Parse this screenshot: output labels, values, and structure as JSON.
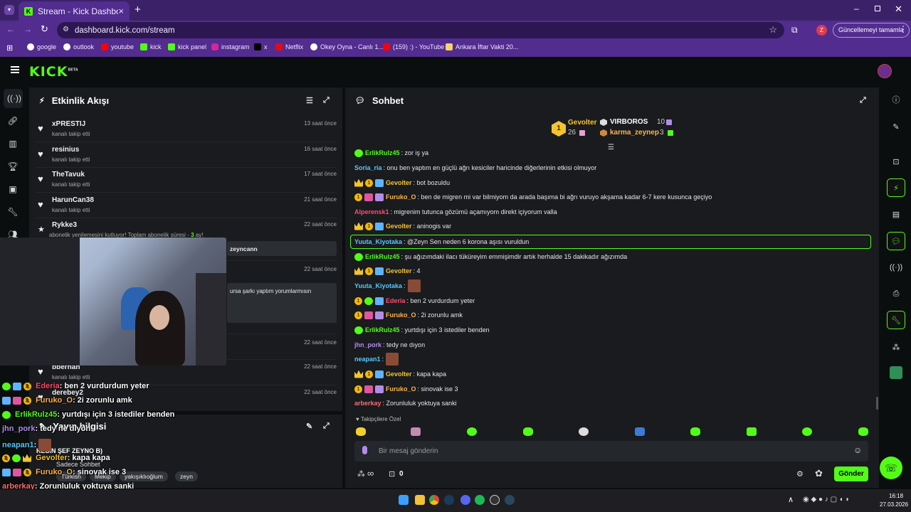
{
  "browser": {
    "tab_title": "Stream - Kick Dashboard",
    "url": "dashboard.kick.com/stream",
    "profile_initial": "Z",
    "update_label": "Güncellemeyi tamamla",
    "bookmarks": [
      "google",
      "outlook",
      "youtube",
      "kick",
      "kick panel",
      "instagram",
      "x",
      "Netflix",
      "Okey Oyna - Canlı 1...",
      "(159) :) - YouTube",
      "Ankara İftar Vakti 20..."
    ]
  },
  "kick": {
    "logo": "KICK",
    "logo_badge": "BETA"
  },
  "activity": {
    "title": "Etkinlik Akışı",
    "items": [
      {
        "name": "xPRESTIJ",
        "sub": "kanalı takip etti",
        "time": "13 saat önce"
      },
      {
        "name": "resinius",
        "sub": "kanalı takip etti",
        "time": "16 saat önce"
      },
      {
        "name": "TheTavuk",
        "sub": "kanalı takip etti",
        "time": "17 saat önce"
      },
      {
        "name": "HarunCan38",
        "sub": "kanalı takip etti",
        "time": "21 saat önce"
      },
      {
        "name": "Rykke3",
        "sub": "abonelik yenilemesini kutluyor! Toplam abonelik süresi - ",
        "sub_months": "3",
        "sub_suffix": " ay!",
        "time": "22 saat önce"
      }
    ],
    "rykke_msg": "zeyncann",
    "hidden_time_1": "22 saat önce",
    "hidden_msg": "ursa şarkı yaptım yorumlarmısın",
    "hidden_time_2": "22 saat önce",
    "bberhan": {
      "name": "bberhan",
      "sub": "kanalı takip etti",
      "time": "22 saat önce"
    },
    "derebey": {
      "name": "derebey2",
      "time": "22 saat önce"
    }
  },
  "stream_info": {
    "title": "Yayın bilgisi",
    "stream_title": "KESİN ŞEF ZEYNO B)",
    "mode": "Sadece Sohbet",
    "tags": [
      "Türkish",
      "Mekip",
      "yakışıklıoğlum",
      "zeyn"
    ]
  },
  "chat": {
    "title": "Sohbet",
    "leaders": [
      {
        "name": "Gevolter",
        "count": "26",
        "rank": "1"
      },
      {
        "name": "VIRBOROS",
        "count": "10"
      },
      {
        "name": "karma_zeynep",
        "count": "3"
      }
    ],
    "messages": [
      {
        "user": "ErlikRulz45",
        "color": "#53fc18",
        "text": "zor iş ya"
      },
      {
        "user": "Soria_ria",
        "color": "#5ac8fa",
        "text": "onu ben yaptım en güçlü ağrı kesiciler haricinde diğerlerinin etkisi olmuyor"
      },
      {
        "user": "Gevolter",
        "color": "#f4c430",
        "text": "bot bozuldu"
      },
      {
        "user": "Furuko_O",
        "color": "#ffb347",
        "text": "ben de migren mi var bilmiyom da arada başıma bi ağrı vuruyo akşama kadar 6-7 kere kusunca geçiyo"
      },
      {
        "user": "Alperensk1",
        "color": "#ff4d6d",
        "text": "migrenim tutunca gözümü açamıyom direkt içiyorum valla"
      },
      {
        "user": "Gevolter",
        "color": "#f4c430",
        "text": "aninogis var"
      },
      {
        "user": "Yuuta_Kiyotaka",
        "color": "#5ac8fa",
        "text": "@Zeyn Sen neden 6 korona aşısı vuruldun"
      },
      {
        "user": "ErlikRulz45",
        "color": "#53fc18",
        "text": "şu ağızımdaki ilacı tüküreyim emmişimdir artık herhalde 15 dakikadır ağızımda"
      },
      {
        "user": "Gevolter",
        "color": "#f4c430",
        "text": "4"
      },
      {
        "user": "Yuuta_Kiyotaka",
        "color": "#5ac8fa",
        "text": ""
      },
      {
        "user": "Ederia",
        "color": "#ff4d6d",
        "text": "ben 2 vurdurdum yeter"
      },
      {
        "user": "Furuko_O",
        "color": "#ffb347",
        "text": "2i zorunlu amk"
      },
      {
        "user": "ErlikRulz45",
        "color": "#53fc18",
        "text": "yurtdışı için 3 istediler benden"
      },
      {
        "user": "jhn_pork",
        "color": "#b28de8",
        "text": "tedy ne dıyon"
      },
      {
        "user": "neapan1",
        "color": "#5ac8fa",
        "text": ""
      },
      {
        "user": "Gevolter",
        "color": "#f4c430",
        "text": "kapa kapa"
      },
      {
        "user": "Furuko_O",
        "color": "#ffb347",
        "text": "sinovak ise 3"
      },
      {
        "user": "arberkay",
        "color": "#ff6b6b",
        "text": "Zorunluluk yoktuya sanki"
      }
    ],
    "followers_only": "Takipçilere Özel",
    "input_placeholder": "Bir mesaj gönderin",
    "infinity_label": "∞",
    "gift_count": "0",
    "send_label": "Gönder"
  },
  "overlay_chat": [
    {
      "user": "Ederia",
      "color": "#ff4d6d",
      "text": ": ben 2 vurdurdum yeter"
    },
    {
      "user": "Furuko_O",
      "color": "#ffb347",
      "text": ": 2i zorunlu amk"
    },
    {
      "user": "ErlikRulz45",
      "color": "#53fc18",
      "text": ": yurtdışı için 3 istediler benden"
    },
    {
      "user": "jhn_pork",
      "color": "#b28de8",
      "text": ": tedy ne dıyon"
    },
    {
      "user": "neapan1",
      "color": "#5ac8fa",
      "text": ":"
    },
    {
      "user": "Gevolter",
      "color": "#f4c430",
      "text": ": kapa kapa"
    },
    {
      "user": "Furuko_O",
      "color": "#ffb347",
      "text": ": sinovak ise 3"
    },
    {
      "user": "arberkay",
      "color": "#ff6b6b",
      "text": ": Zorunluluk yoktuya sanki"
    }
  ],
  "taskbar": {
    "time": "16:18",
    "date": "27.03.2026"
  }
}
